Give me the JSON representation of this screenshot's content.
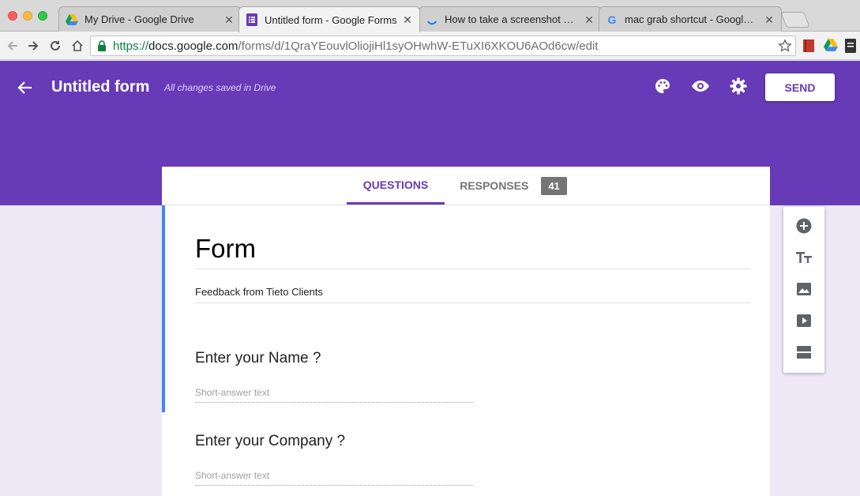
{
  "browser": {
    "tabs": [
      {
        "title": "My Drive - Google Drive",
        "icon": "google-drive-icon",
        "active": false
      },
      {
        "title": "Untitled form - Google Forms",
        "icon": "google-forms-icon",
        "active": true
      },
      {
        "title": "How to take a screenshot on M",
        "icon": "loading-spinner-icon",
        "active": false
      },
      {
        "title": "mac grab shortcut - Google Se",
        "icon": "google-g-icon",
        "active": false
      }
    ],
    "url": {
      "protocol": "https://",
      "host": "docs.google.com",
      "path": "/forms/d/1QraYEouvlOliojiHl1syOHwhW-ETuXI6XKOU6AOd6cw/edit"
    }
  },
  "header": {
    "title": "Untitled form",
    "save_status": "All changes saved in Drive",
    "send_label": "SEND",
    "color": "#673ab7"
  },
  "tabs": {
    "questions": "QUESTIONS",
    "responses": "RESPONSES",
    "responses_count": "41"
  },
  "form": {
    "title": "Form",
    "description": "Feedback from Tieto Clients",
    "questions": [
      {
        "label": "Enter your Name ?",
        "placeholder": "Short-answer text"
      },
      {
        "label": "Enter your Company ?",
        "placeholder": "Short-answer text"
      }
    ]
  },
  "side_tools": [
    "add-question-icon",
    "add-title-icon",
    "add-image-icon",
    "add-video-icon",
    "add-section-icon"
  ]
}
